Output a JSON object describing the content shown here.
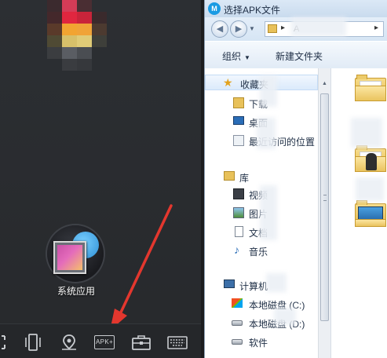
{
  "emulator": {
    "app_label": "系统应用",
    "nav_apk_label": "APK+",
    "colors": {
      "background": "#2a2d30",
      "arrow": "#e3372e"
    }
  },
  "dialog": {
    "title": "选择APK文件",
    "address": {
      "path": "A"
    },
    "toolbar": {
      "organize": "组织",
      "new_folder": "新建文件夹"
    },
    "tree": {
      "favorites": "收藏夹",
      "downloads": "下载",
      "desktop": "桌面",
      "recent": "最近访问的位置",
      "libraries": "库",
      "videos": "视频",
      "pictures": "图片",
      "documents": "文档",
      "music": "音乐",
      "computer": "计算机",
      "local_c": "本地磁盘 (C:)",
      "local_d": "本地磁盘 (D:)",
      "software": "软件"
    },
    "colors": {
      "titlebar": "#c9dbee",
      "folder": "#e4b94b"
    }
  }
}
